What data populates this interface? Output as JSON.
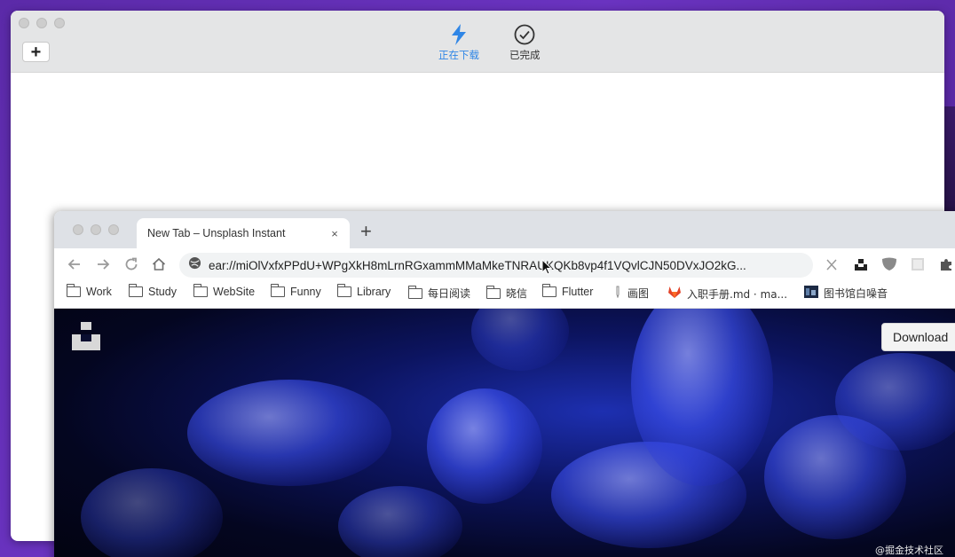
{
  "downloader": {
    "add_label": "+",
    "tabs": [
      {
        "label": "正在下载",
        "icon": "lightning-icon",
        "active": true,
        "color": "#2f86e6"
      },
      {
        "label": "已完成",
        "icon": "checkmark-circle-icon",
        "active": false
      }
    ]
  },
  "browser": {
    "tab_title": "New Tab – Unsplash Instant",
    "tab_close": "×",
    "new_tab": "+",
    "address": "ear://miOlVxfxPPdU+WPgXkH8mLrnRGxammMMaMkeTNRAUKQKb8vp4f1VQvlCJN50DVxJO2kG...",
    "bookmarks": [
      {
        "label": "Work",
        "icon": "folder-icon"
      },
      {
        "label": "Study",
        "icon": "folder-icon"
      },
      {
        "label": "WebSite",
        "icon": "folder-icon"
      },
      {
        "label": "Funny",
        "icon": "folder-icon"
      },
      {
        "label": "Library",
        "icon": "folder-icon"
      },
      {
        "label": "每日阅读",
        "icon": "folder-icon"
      },
      {
        "label": "晓信",
        "icon": "folder-icon"
      },
      {
        "label": "Flutter",
        "icon": "folder-icon"
      },
      {
        "label": "画图",
        "icon": "pencil-icon"
      },
      {
        "label": "入职手册.md · ma...",
        "icon": "gitlab-icon"
      },
      {
        "label": "图书馆白噪音",
        "icon": "noise-thumbnail-icon"
      }
    ],
    "page": {
      "download_label": "Download",
      "watermark": "@掘金技术社区"
    }
  },
  "colors": {
    "accent": "#2f86e6",
    "desktop": "#5b2aa8"
  }
}
